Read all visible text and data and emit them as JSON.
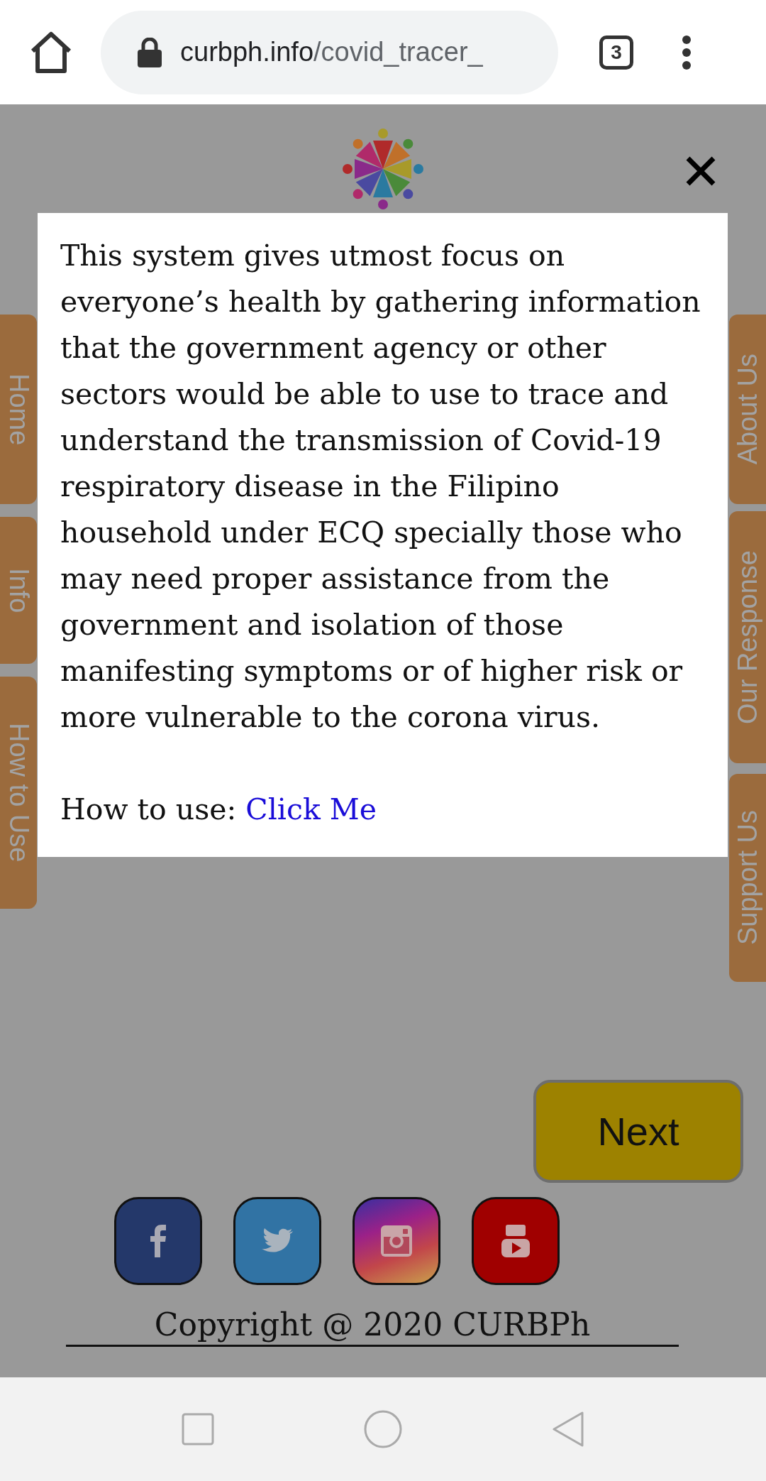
{
  "browser": {
    "url_host": "curbph.info",
    "url_path": "/covid_tracer_",
    "tab_count": "3"
  },
  "side_tabs_left": [
    {
      "label": "Home"
    },
    {
      "label": "Info"
    },
    {
      "label": "How to Use"
    }
  ],
  "side_tabs_right": [
    {
      "label": "About Us"
    },
    {
      "label": "Our Response"
    },
    {
      "label": "Support Us"
    }
  ],
  "modal": {
    "body": "This system gives utmost focus on everyone’s health by gathering information that the government agency or other sectors would be able to use to trace and understand the transmission of Covid-19 respiratory disease in the Filipino household under ECQ specially those who may need proper assistance from the government and isolation of those manifesting symptoms or of higher risk or more vulnerable to the corona virus.",
    "how_to_label": "How to use:",
    "link": "Click Me"
  },
  "next_button": "Next",
  "social": [
    {
      "kind": "facebook"
    },
    {
      "kind": "twitter"
    },
    {
      "kind": "instagram"
    },
    {
      "kind": "youtube"
    }
  ],
  "copyright": "Copyright @ 2020 CURBPh"
}
